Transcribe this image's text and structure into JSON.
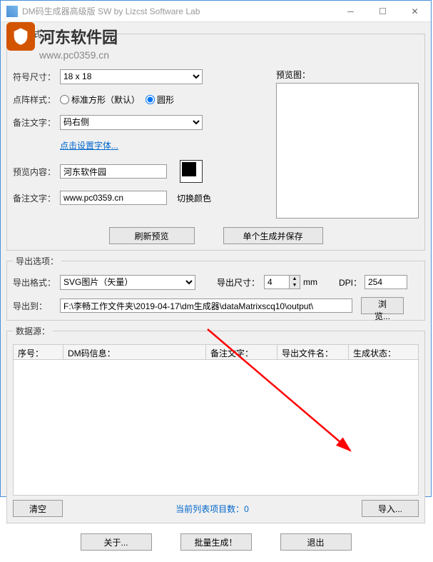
{
  "titlebar": "DM码生成器高级版 SW   by Lizcst Software Lab",
  "watermark": {
    "text": "河东软件园",
    "url": "www.pc0359.cn"
  },
  "section1": {
    "legend": "码样式：",
    "symbol_size_lbl": "符号尺寸：",
    "symbol_size_val": "18 x 18",
    "dot_style_lbl": "点阵样式：",
    "radio_square": "标准方形（默认）",
    "radio_circle": "圆形",
    "note_text_lbl": "备注文字：",
    "note_text_val": "码右侧",
    "font_link": "点击设置字体...",
    "preview_content_lbl": "预览内容：",
    "preview_content_val": "河东软件园",
    "note_text2_lbl": "备注文字：",
    "note_text2_val": "www.pc0359.cn",
    "preview_lbl": "预览图：",
    "color_lbl": "切换颜色",
    "refresh_btn": "刷新预览",
    "save_btn": "单个生成并保存"
  },
  "section2": {
    "legend": "导出选项：",
    "format_lbl": "导出格式：",
    "format_val": "SVG图片（矢量）",
    "size_lbl": "导出尺寸：",
    "size_val": "4",
    "size_unit": "mm",
    "dpi_lbl": "DPI：",
    "dpi_val": "254",
    "export_to_lbl": "导出到：",
    "export_to_val": "F:\\李畅工作文件夹\\2019-04-17\\dm生成器\\dataMatrixscq10\\output\\",
    "browse_btn": "浏览..."
  },
  "section3": {
    "legend": "数据源：",
    "cols": {
      "seq": "序号：",
      "info": "DM码信息：",
      "note": "备注文字：",
      "filename": "导出文件名：",
      "status": "生成状态："
    },
    "clear_btn": "清空",
    "status_text": "当前列表项目数：0",
    "import_btn": "导入..."
  },
  "footer": {
    "about": "关于...",
    "batch": "批量生成！",
    "exit": "退出"
  }
}
